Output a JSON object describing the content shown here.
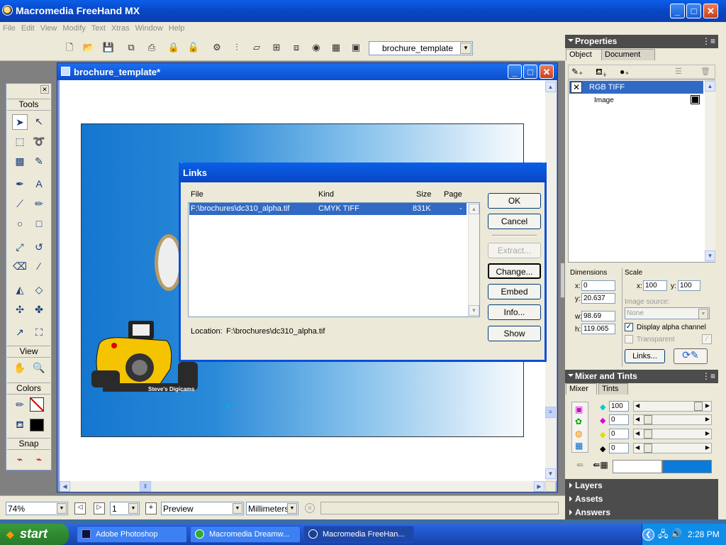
{
  "app": {
    "title": "Macromedia FreeHand MX",
    "icon": "freehand-app-icon"
  },
  "menu": [
    "File",
    "Edit",
    "View",
    "Modify",
    "Text",
    "Xtras",
    "Window",
    "Help"
  ],
  "toolbar": {
    "doc_select": "brochure_template"
  },
  "document": {
    "title": "brochure_template*",
    "watermark": "Steve's Digicams"
  },
  "tools": {
    "sections": [
      "Tools",
      "View",
      "Colors",
      "Snap"
    ]
  },
  "properties": {
    "header": "Properties",
    "tabs": [
      "Object",
      "Document"
    ],
    "tree": [
      {
        "label": "RGB TIFF"
      },
      {
        "label": "Image"
      }
    ],
    "dimensions_label": "Dimensions",
    "scale_label": "Scale",
    "x_label": "x:",
    "y_label": "y:",
    "w_label": "w:",
    "h_label": "h:",
    "x": "0",
    "y": "20.637",
    "w": "98.69",
    "h": "119.065",
    "scale_x": "100",
    "scale_y": "100",
    "image_source_label": "Image source:",
    "image_source": "None",
    "display_alpha": "Display alpha channel",
    "transparent": "Transparent",
    "links_button": "Links..."
  },
  "mixer": {
    "header": "Mixer and Tints",
    "tabs": [
      "Mixer",
      "Tints"
    ],
    "values": [
      "100",
      "0",
      "0",
      "0"
    ],
    "swatch_color": "#0a7bd9"
  },
  "collapsed_panels": [
    "Layers",
    "Assets",
    "Answers"
  ],
  "links_dialog": {
    "title": "Links",
    "columns": [
      "File",
      "Kind",
      "Size",
      "Page"
    ],
    "rows": [
      {
        "file": "F:\\brochures\\dc310_alpha.tif",
        "kind": "CMYK TIFF",
        "size": "831K",
        "page": "-"
      }
    ],
    "location_label": "Location:",
    "location": "F:\\brochures\\dc310_alpha.tif",
    "buttons": [
      "OK",
      "Cancel",
      "Extract...",
      "Change...",
      "Embed",
      "Info...",
      "Show"
    ]
  },
  "status": {
    "zoom": "74%",
    "page": "1",
    "view_mode": "Preview",
    "units": "Millimeters"
  },
  "taskbar": {
    "start": "start",
    "tasks": [
      "Adobe Photoshop",
      "Macromedia Dreamw...",
      "Macromedia FreeHan..."
    ],
    "clock": "2:28 PM"
  }
}
